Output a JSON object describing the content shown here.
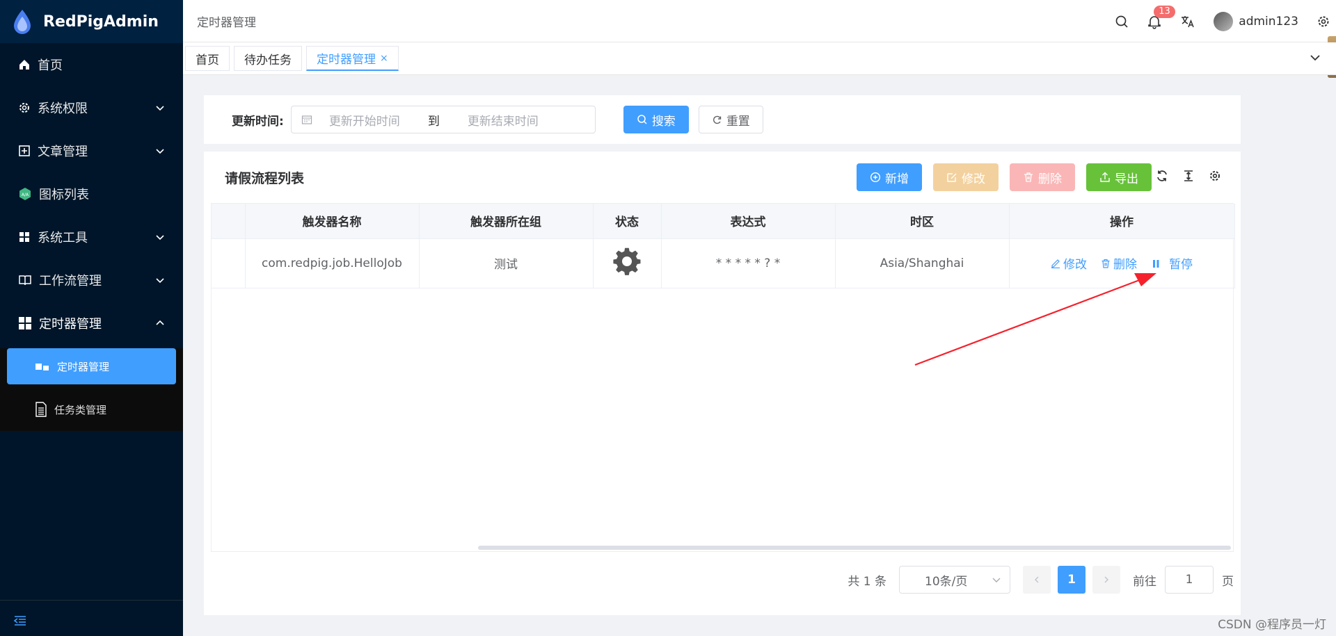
{
  "app": {
    "name": "RedPigAdmin"
  },
  "sidebar": {
    "items": [
      {
        "label": "首页",
        "icon": "home-icon"
      },
      {
        "label": "系统权限",
        "icon": "gear-icon"
      },
      {
        "label": "文章管理",
        "icon": "plus-square-icon"
      },
      {
        "label": "图标列表",
        "icon": "hex-icon"
      },
      {
        "label": "系统工具",
        "icon": "grid-icon"
      },
      {
        "label": "工作流管理",
        "icon": "book-icon"
      },
      {
        "label": "定时器管理",
        "icon": "windows-icon"
      }
    ],
    "submenu": [
      {
        "label": "定时器管理",
        "icon": "timer-icon"
      },
      {
        "label": "任务类管理",
        "icon": "document-icon"
      }
    ]
  },
  "header": {
    "title": "定时器管理",
    "notifications": "13",
    "username": "admin123"
  },
  "tabs": [
    {
      "label": "首页"
    },
    {
      "label": "待办任务"
    },
    {
      "label": "定时器管理",
      "close": "×"
    }
  ],
  "search": {
    "label": "更新时间:",
    "start_placeholder": "更新开始时间",
    "sep": "到",
    "end_placeholder": "更新结束时间",
    "search_btn": "搜索",
    "reset_btn": "重置"
  },
  "table": {
    "title": "请假流程列表",
    "toolbar": {
      "add": "新增",
      "edit": "修改",
      "delete": "删除",
      "export": "导出"
    },
    "columns": [
      "触发器名称",
      "触发器所在组",
      "状态",
      "表达式",
      "时区",
      "操作"
    ],
    "rows": [
      {
        "name": "com.redpig.job.HelloJob",
        "group": "测试",
        "status_icon": "gear-icon",
        "expression": "* * * * * ? *",
        "timezone": "Asia/Shanghai",
        "actions": {
          "edit": "修改",
          "delete": "删除",
          "pause": "暂停"
        }
      }
    ]
  },
  "pagination": {
    "total": "共 1 条",
    "page_size": "10条/页",
    "current": "1",
    "goto_label": "前往",
    "goto_value": "1",
    "page_unit": "页"
  },
  "watermark": "CSDN @程序员一灯",
  "colors": {
    "primary": "#409eff",
    "sidebar": "#001529",
    "annotation_arrow": "#f5222d"
  }
}
